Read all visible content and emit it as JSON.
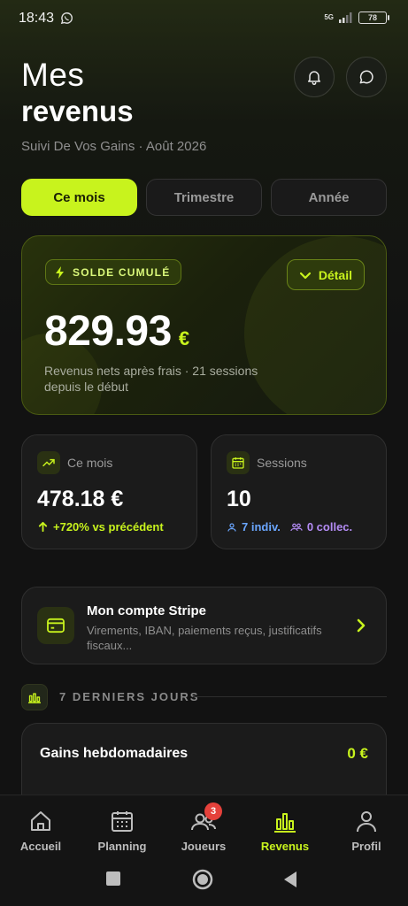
{
  "status_bar": {
    "time": "18:43",
    "network": "5G",
    "battery": "78"
  },
  "header": {
    "title_line1": "Mes",
    "title_line2": "revenus",
    "subtitle": "Suivi De Vos Gains · Août 2026"
  },
  "tabs": [
    {
      "label": "Ce mois",
      "active": true
    },
    {
      "label": "Trimestre",
      "active": false
    },
    {
      "label": "Année",
      "active": false
    }
  ],
  "balance": {
    "badge": "SOLDE CUMULÉ",
    "detail_label": "Détail",
    "amount": "829.93",
    "currency": "€",
    "note": "Revenus nets après frais · 21 sessions depuis le début"
  },
  "stats": {
    "month": {
      "label": "Ce mois",
      "value": "478.18 €",
      "trend": "+720% vs précédent"
    },
    "sessions": {
      "label": "Sessions",
      "value": "10",
      "individual": "7 indiv.",
      "collective": "0 collec."
    }
  },
  "stripe": {
    "title": "Mon compte Stripe",
    "description": "Virements, IBAN, paiements reçus, justificatifs fiscaux..."
  },
  "section": {
    "title": "7 DERNIERS JOURS"
  },
  "weekly": {
    "title": "Gains hebdomadaires",
    "value": "0 €"
  },
  "nav": {
    "items": [
      {
        "label": "Accueil",
        "icon": "home-icon"
      },
      {
        "label": "Planning",
        "icon": "calendar-icon"
      },
      {
        "label": "Joueurs",
        "icon": "users-icon",
        "badge": "3"
      },
      {
        "label": "Revenus",
        "icon": "bar-chart-icon",
        "active": true
      },
      {
        "label": "Profil",
        "icon": "user-icon"
      }
    ]
  },
  "colors": {
    "accent": "#c8f31d",
    "background": "#121212",
    "card": "#1b1b1b",
    "badge_red": "#e5413b",
    "blue": "#6aa6ff",
    "purple": "#b48cf5"
  }
}
